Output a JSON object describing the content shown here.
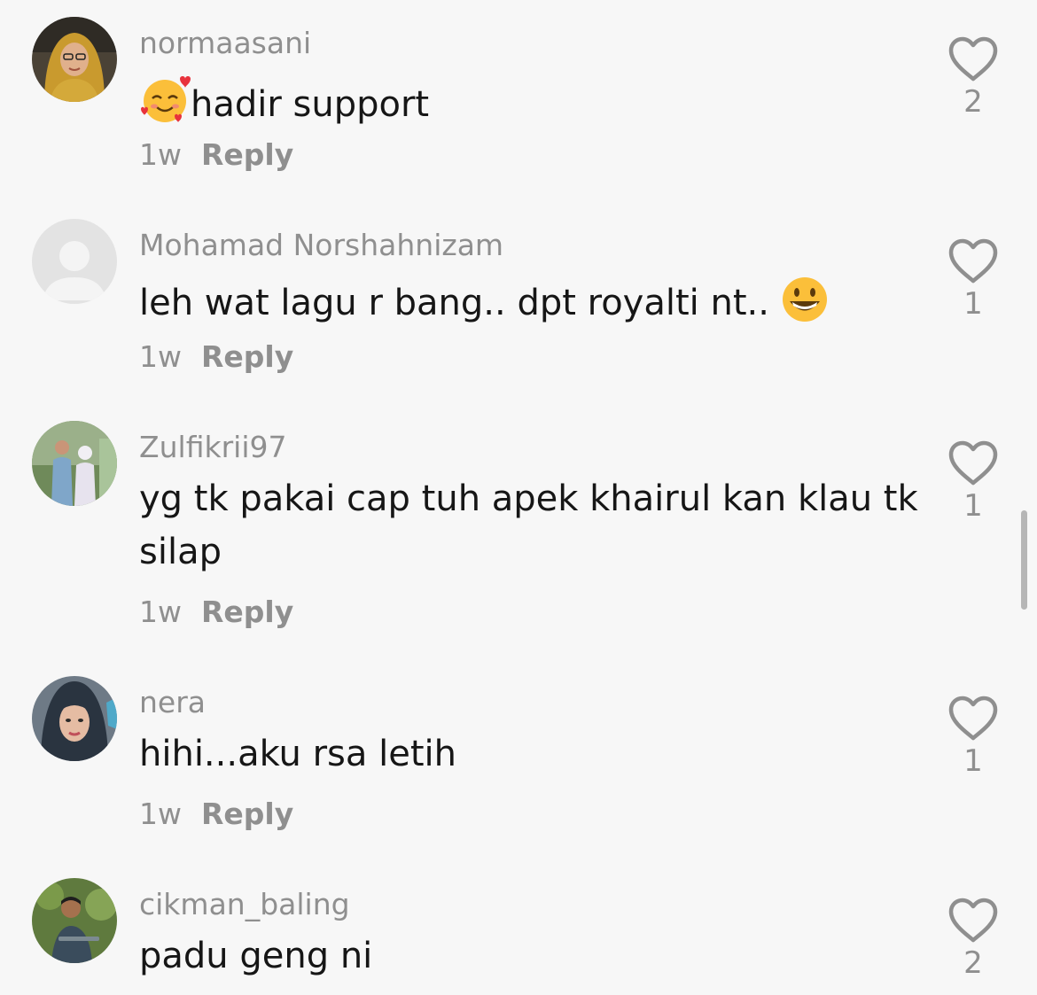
{
  "comments": [
    {
      "username": "normaasani",
      "text": "hadir support",
      "leading_emoji": "smiling-face-with-hearts",
      "trailing_emoji": "",
      "time": "1w",
      "reply_label": "Reply",
      "likes": "2"
    },
    {
      "username": "Mohamad Norshahnizam",
      "text": "leh wat lagu r bang.. dpt royalti nt..",
      "leading_emoji": "",
      "trailing_emoji": "grinning-face",
      "time": "1w",
      "reply_label": "Reply",
      "likes": "1"
    },
    {
      "username": "Zulfikrii97",
      "text": "yg tk pakai cap tuh apek khairul kan klau tk silap",
      "leading_emoji": "",
      "trailing_emoji": "",
      "time": "1w",
      "reply_label": "Reply",
      "likes": "1"
    },
    {
      "username": "nera",
      "text": "hihi...aku rsa letih",
      "leading_emoji": "",
      "trailing_emoji": "",
      "time": "1w",
      "reply_label": "Reply",
      "likes": "1"
    },
    {
      "username": "cikman_baling",
      "text": "padu geng ni",
      "leading_emoji": "",
      "trailing_emoji": "",
      "time": "",
      "reply_label": "",
      "likes": "2"
    }
  ],
  "icons": {
    "like": "heart-outline-icon",
    "default_avatar": "person-silhouette-icon"
  },
  "colors": {
    "background": "#f7f7f7",
    "text": "#161616",
    "secondary": "#8f8f8f"
  }
}
